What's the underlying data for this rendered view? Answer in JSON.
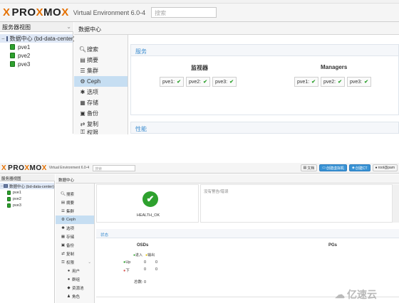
{
  "brand": {
    "prefix": "PRO",
    "x": "X",
    "o": "O",
    "suffix": "MO",
    "x2": "X"
  },
  "top": {
    "version": "Virtual Environment 6.0-4",
    "search_placeholder": "搜索",
    "tree_view": "服务器视图",
    "datacenter": "数据中心 (bd-data-center)",
    "nodes": [
      "pve1",
      "pve2",
      "pve3"
    ],
    "title": "数据中心",
    "nav": [
      "搜索",
      "摘要",
      "集群",
      "Ceph",
      "选项",
      "存储",
      "备份",
      "复制",
      "权限"
    ],
    "selected_nav": "Ceph",
    "services_panel": "服务",
    "monitors_label": "监视器",
    "managers_label": "Managers",
    "monitors": [
      "pve1:",
      "pve2:",
      "pve3:"
    ],
    "managers": [
      "pve1:",
      "pve2:",
      "pve3:"
    ],
    "performance_panel": "性能"
  },
  "bottom": {
    "version": "Virtual Environment 6.0-4",
    "search_placeholder": "搜索",
    "buttons": {
      "docs": "文档",
      "create_vm": "创建虚拟机",
      "create_ct": "创建CT",
      "user": "root@pam"
    },
    "tree_view": "服务器视图",
    "datacenter": "数据中心 (bd-data-center)",
    "nodes": [
      "pve1",
      "pve2",
      "pve3"
    ],
    "title": "数据中心",
    "nav": [
      "搜索",
      "摘要",
      "集群",
      "Ceph",
      "选项",
      "存储",
      "备份",
      "复制",
      "权限",
      "用户",
      "群组",
      "资源池",
      "角色"
    ],
    "selected_nav": "Ceph",
    "health": "HEALTH_OK",
    "warnings": "没有警告/错误",
    "status_panel": "状态",
    "osds_label": "OSDs",
    "pgs_label": "PGs",
    "osd_in": "进入",
    "osd_out": "输出",
    "osd_up": "Up",
    "osd_down": "下",
    "osd_up_in": "0",
    "osd_up_out": "0",
    "osd_down_in": "0",
    "osd_down_out": "0",
    "osd_total": "总数: 0"
  },
  "watermark": "亿速云",
  "colors": {
    "accent": "#e57000",
    "selected": "#c6def2",
    "ok": "#2ea12e",
    "link": "#3e8ed0"
  }
}
